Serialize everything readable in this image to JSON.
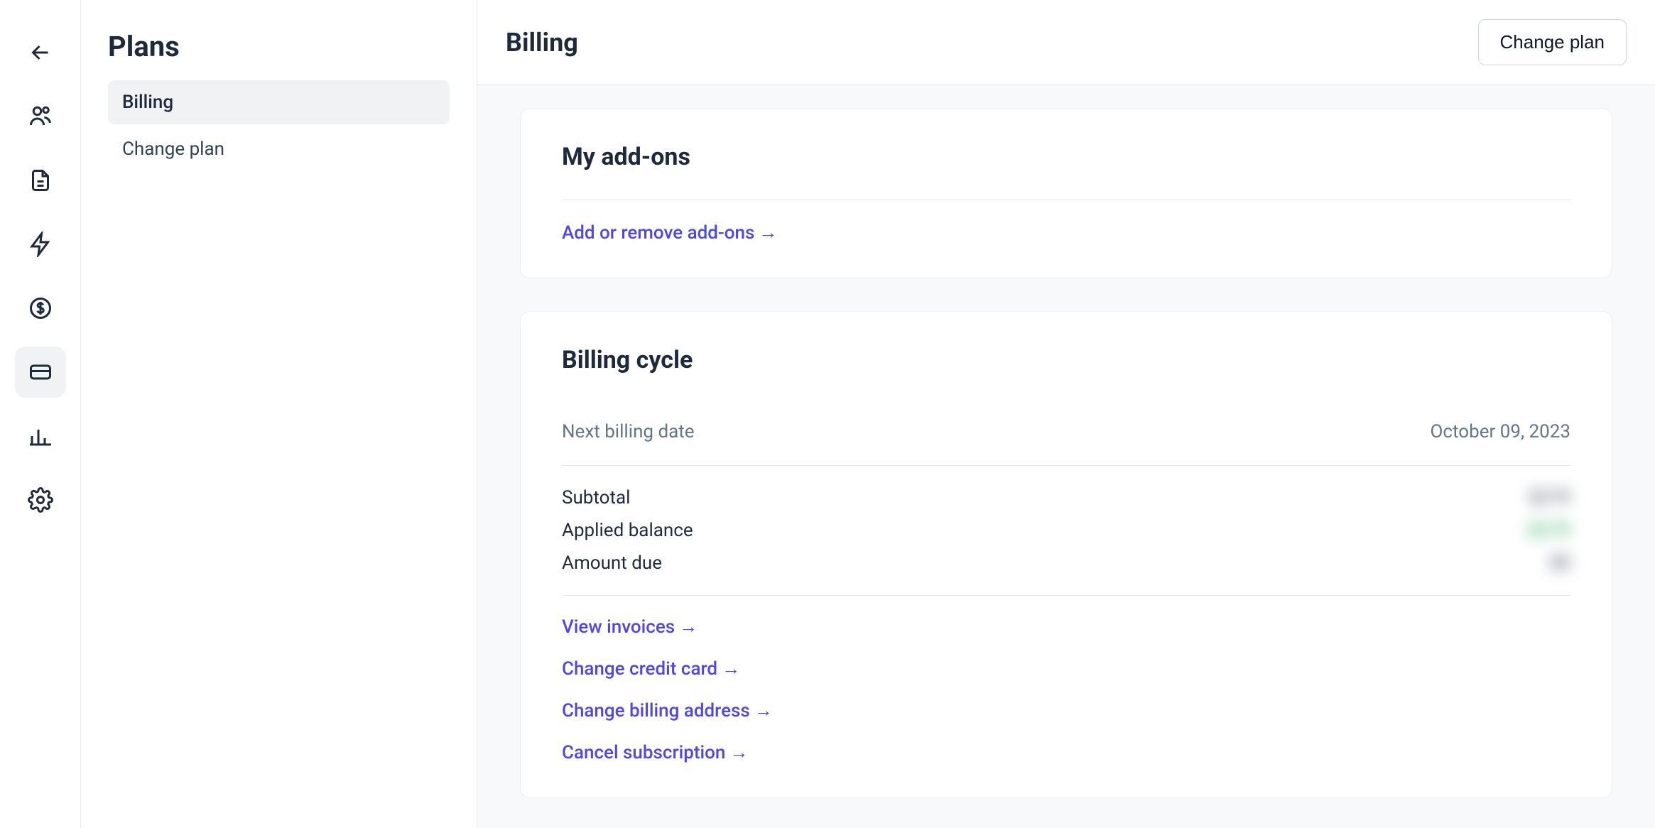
{
  "sidebar": {
    "title": "Plans",
    "items": [
      {
        "label": "Billing"
      },
      {
        "label": "Change plan"
      }
    ]
  },
  "topbar": {
    "title": "Billing",
    "change_plan_button": "Change plan"
  },
  "addons": {
    "title": "My add-ons",
    "link": "Add or remove add-ons"
  },
  "billing_cycle": {
    "title": "Billing cycle",
    "next_label": "Next billing date",
    "next_value": "October 09, 2023",
    "subtotal_label": "Subtotal",
    "subtotal_value": "$279",
    "applied_label": "Applied balance",
    "applied_value": "-$279",
    "due_label": "Amount due",
    "due_value": "$0",
    "links": {
      "invoices": "View invoices",
      "credit_card": "Change credit card",
      "billing_address": "Change billing address",
      "cancel": "Cancel subscription"
    }
  },
  "arrow": "→"
}
